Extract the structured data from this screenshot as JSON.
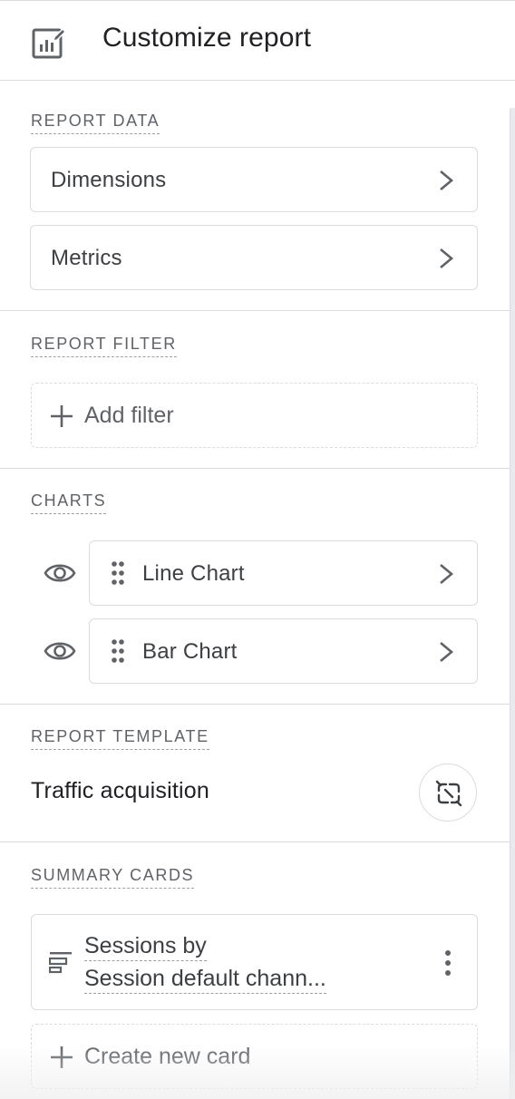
{
  "header": {
    "title": "Customize report",
    "icon": "report-edit-icon"
  },
  "report_data": {
    "label": "REPORT DATA",
    "items": [
      {
        "label": "Dimensions",
        "icon": "chevron-right-icon"
      },
      {
        "label": "Metrics",
        "icon": "chevron-right-icon"
      }
    ]
  },
  "report_filter": {
    "label": "REPORT FILTER",
    "add_label": "Add filter"
  },
  "charts": {
    "label": "CHARTS",
    "items": [
      {
        "label": "Line Chart",
        "visible": true
      },
      {
        "label": "Bar Chart",
        "visible": true
      }
    ]
  },
  "report_template": {
    "label": "REPORT TEMPLATE",
    "name": "Traffic acquisition",
    "action_icon": "unlink-icon"
  },
  "summary_cards": {
    "label": "SUMMARY CARDS",
    "cards": [
      {
        "line1": "Sessions by",
        "line2": "Session default chann..."
      }
    ],
    "create_label": "Create new card"
  },
  "colors": {
    "text": "#202124",
    "muted": "#5f6368",
    "border": "#dadce0",
    "icon": "#5f6368"
  }
}
